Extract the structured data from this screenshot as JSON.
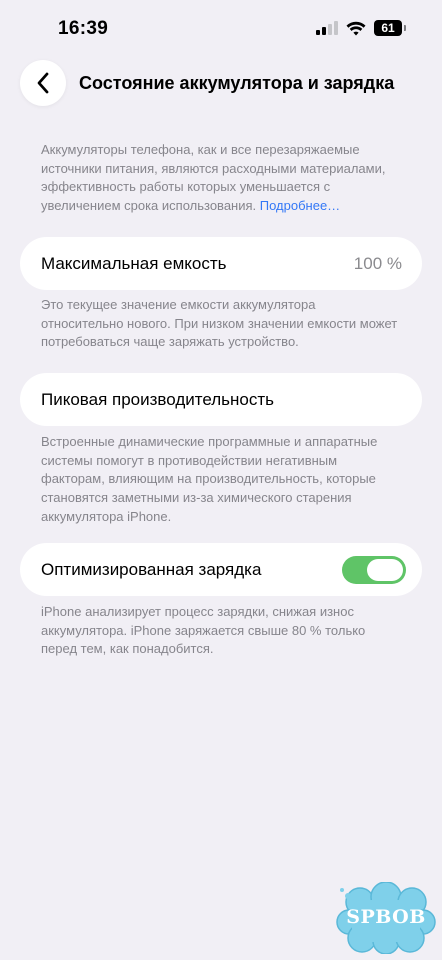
{
  "status_bar": {
    "time": "16:39",
    "battery_level": "61"
  },
  "nav": {
    "title": "Состояние аккумулятора и зарядка"
  },
  "intro": {
    "text": "Аккумуляторы телефона, как и все перезаряжаемые источники питания, являются расходными материалами, эффективность работы которых уменьшается с увеличением срока использования.",
    "link": "Подробнее…"
  },
  "max_capacity": {
    "label": "Максимальная емкость",
    "value": "100 %",
    "description": "Это текущее значение емкости аккумулятора относительно нового. При низком значении емкости может потребоваться чаще заряжать устройство."
  },
  "peak_performance": {
    "label": "Пиковая производительность",
    "description": "Встроенные динамические программные и аппаратные системы помогут в противодействии негативным факторам, влияющим на производительность, которые становятся заметными из-за химического старения аккумулятора iPhone."
  },
  "optimized_charging": {
    "label": "Оптимизированная зарядка",
    "enabled": true,
    "description": "iPhone анализирует процесс зарядки, снижая износ аккумулятора. iPhone заряжается свыше 80 % только перед тем, как понадобится."
  },
  "watermark": {
    "text": "SPBOB"
  },
  "colors": {
    "background": "#f1eff5",
    "card": "#ffffff",
    "secondary_text": "#86858c",
    "link": "#3478f6",
    "toggle_on": "#5fc467"
  }
}
